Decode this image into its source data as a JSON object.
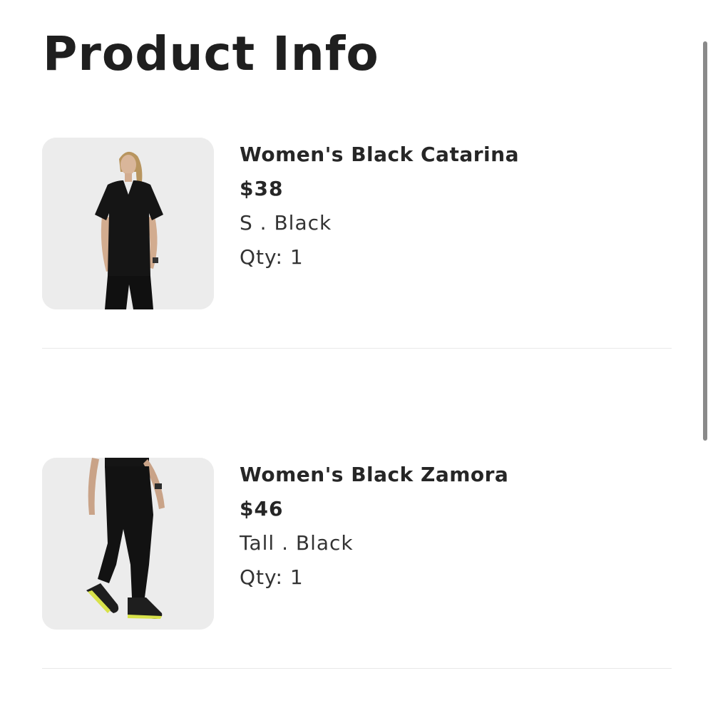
{
  "page": {
    "title": "Product Info"
  },
  "products": [
    {
      "name": "Women's Black Catarina",
      "price": "$38",
      "variant": "S . Black",
      "qty": "Qty: 1",
      "image_icon": "scrub-top-model-photo"
    },
    {
      "name": "Women's Black Zamora",
      "price": "$46",
      "variant": "Tall . Black",
      "qty": "Qty: 1",
      "image_icon": "jogger-pants-model-photo"
    }
  ],
  "colors": {
    "text": "#262626",
    "thumb_bg": "#ececec",
    "divider": "#e9e9e9",
    "scrollbar": "#8a8a8a"
  }
}
